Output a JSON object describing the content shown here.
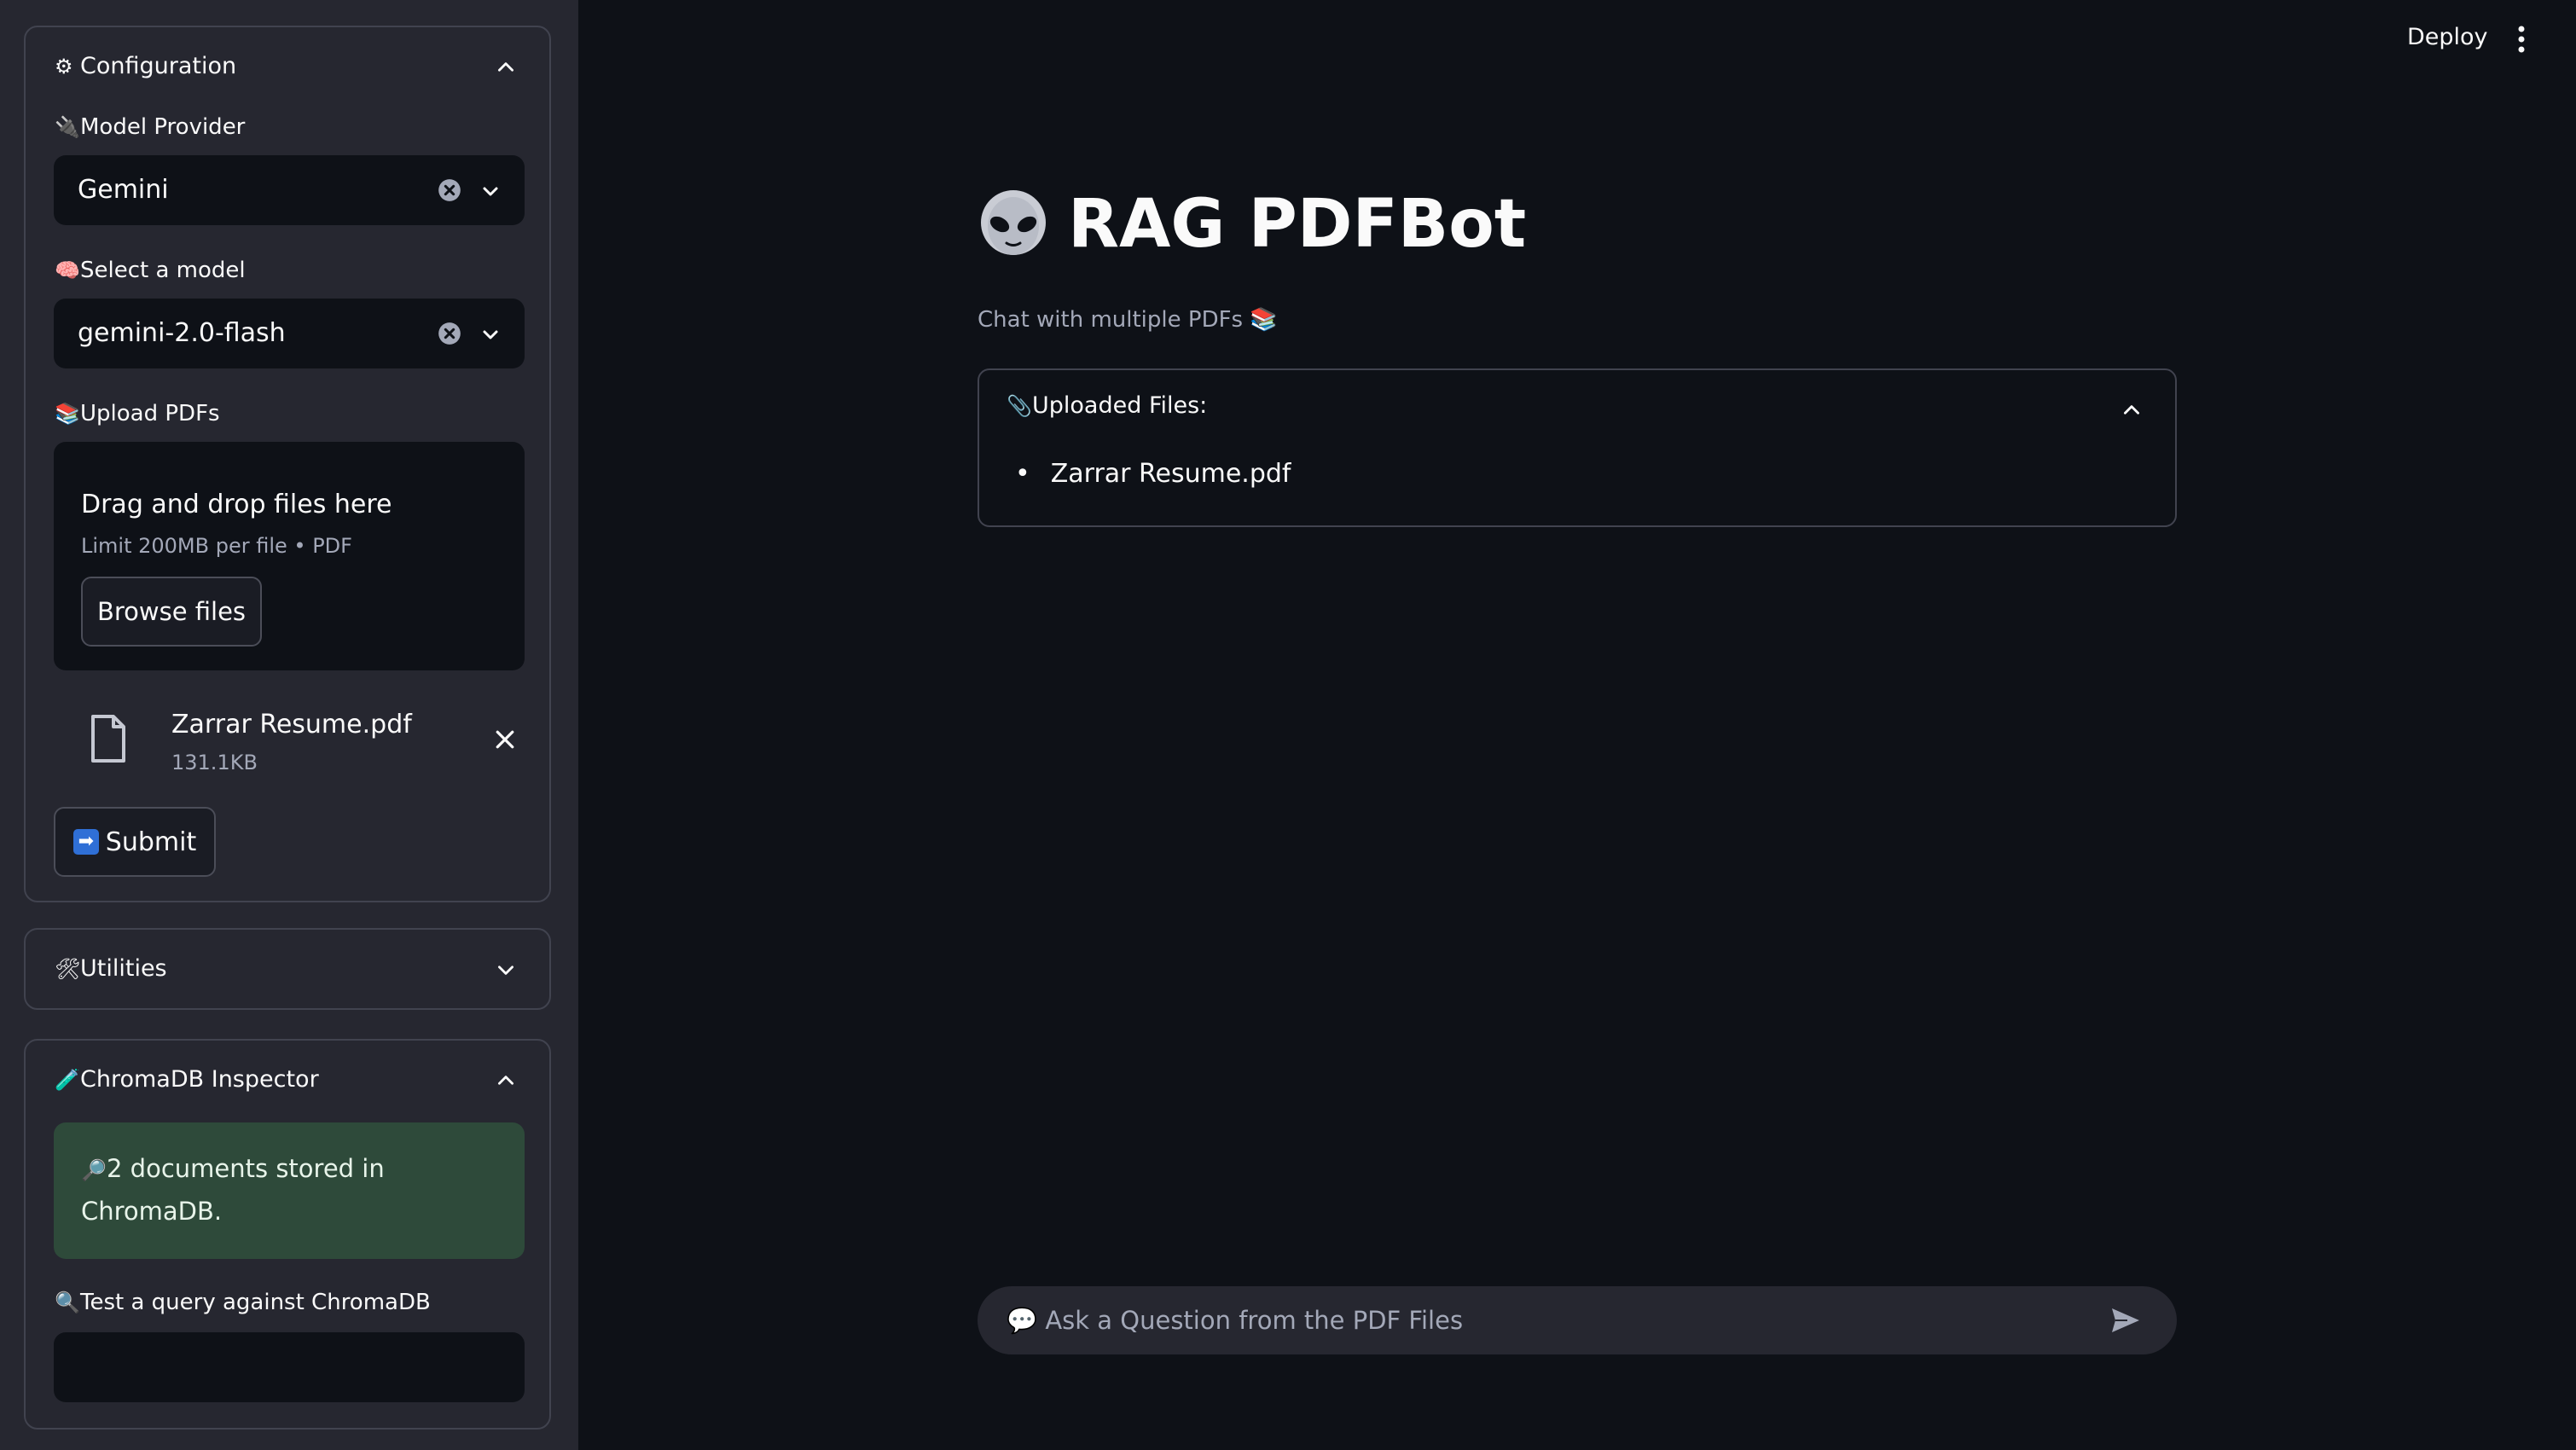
{
  "sidebar": {
    "configuration": {
      "title": "Configuration",
      "title_icon": "⚙",
      "model_provider_label": "Model Provider",
      "model_provider_icon": "🔌",
      "model_provider_value": "Gemini",
      "model_label": "Select a model",
      "model_icon": "🧠",
      "model_value": "gemini-2.0-flash",
      "upload_label": "Upload PDFs",
      "upload_icon": "📚",
      "dropzone_title": "Drag and drop files here",
      "dropzone_limit": "Limit 200MB per file • PDF",
      "browse_label": "Browse files",
      "file": {
        "name": "Zarrar Resume.pdf",
        "size": "131.1KB"
      },
      "submit_label": "Submit",
      "submit_icon": "➡"
    },
    "utilities": {
      "title": "Utilities",
      "title_icon": "🛠"
    },
    "chromadb": {
      "title": "ChromaDB Inspector",
      "title_icon": "🧪",
      "status_icon": "🔎",
      "status_text": "2 documents stored in ChromaDB.",
      "query_label": "Test a query against ChromaDB",
      "query_icon": "🔍",
      "query_value": ""
    }
  },
  "header": {
    "deploy_label": "Deploy"
  },
  "main": {
    "title": "RAG PDFBot",
    "caption": "Chat with multiple PDFs 📚",
    "uploaded_files_title": "Uploaded Files:",
    "uploaded_files_icon": "📎",
    "uploaded_files": [
      "Zarrar Resume.pdf"
    ],
    "chat_placeholder": "💬 Ask a Question from the PDF Files"
  },
  "colors": {
    "background": "#0e1117",
    "sidebar": "#262730",
    "border": "#41434f",
    "success": "#2e4a3a",
    "muted_text": "#a3a8b8"
  }
}
